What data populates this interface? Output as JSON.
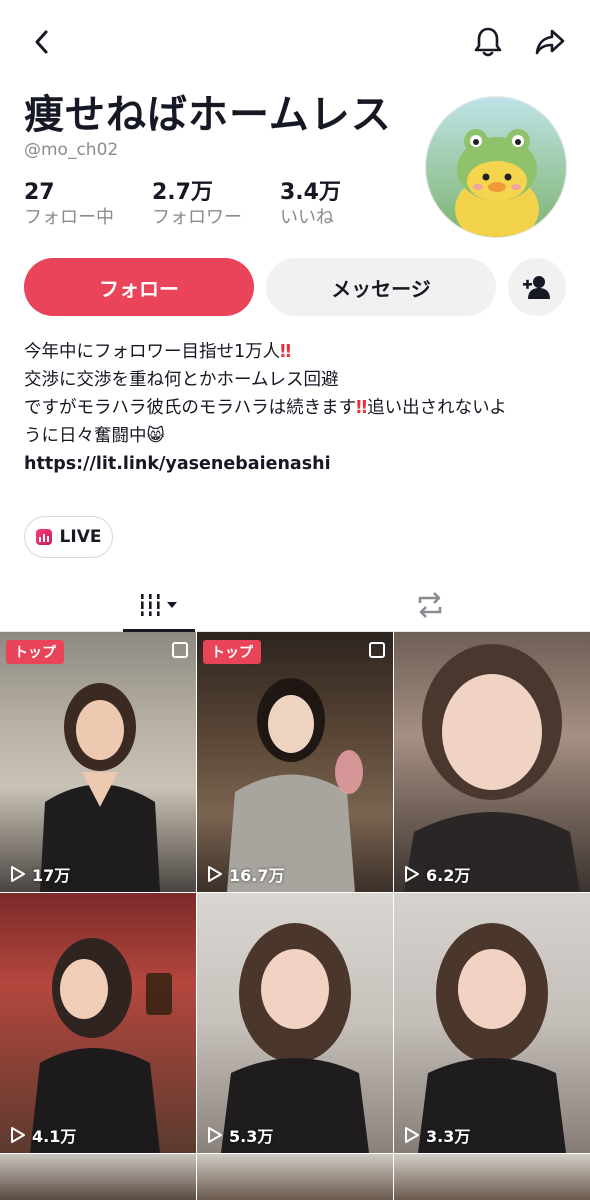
{
  "profile": {
    "display_name": "痩せねばホームレス",
    "handle": "@mo_ch02",
    "stats": [
      {
        "value": "27",
        "label": "フォロー中"
      },
      {
        "value": "2.7万",
        "label": "フォロワー"
      },
      {
        "value": "3.4万",
        "label": "いいね"
      }
    ]
  },
  "actions": {
    "follow_label": "フォロー",
    "message_label": "メッセージ"
  },
  "bio": {
    "line1": "今年中にフォロワー目指せ1万人",
    "line2": "交渉に交渉を重ね何とかホームレス回避",
    "line3a": "ですがモラハラ彼氏のモラハラは続きます",
    "line3b": "追い出されないよ",
    "line4": "うに日々奮闘中",
    "link": "https://lit.link/yasenebaienashi",
    "bang_emoji": "‼",
    "cat_emoji": "😸"
  },
  "live": {
    "label": "LIVE"
  },
  "colors": {
    "accent": "#ea445a",
    "secondary_bg": "#f1f1f2",
    "muted_text": "#8a8b91"
  },
  "videos": [
    {
      "views": "17万",
      "badge": "トップ",
      "multi": true
    },
    {
      "views": "16.7万",
      "badge": "トップ",
      "multi": true
    },
    {
      "views": "6.2万",
      "badge": "",
      "multi": false
    },
    {
      "views": "4.1万",
      "badge": "",
      "multi": false
    },
    {
      "views": "5.3万",
      "badge": "",
      "multi": false
    },
    {
      "views": "3.3万",
      "badge": "",
      "multi": false
    }
  ],
  "icons": {
    "back": "chevron-left-icon",
    "notifications": "bell-icon",
    "share": "share-arrow-icon",
    "add_friend": "add-user-icon",
    "videos_tab": "grid-bars-icon",
    "reposts_tab": "repost-icon"
  }
}
